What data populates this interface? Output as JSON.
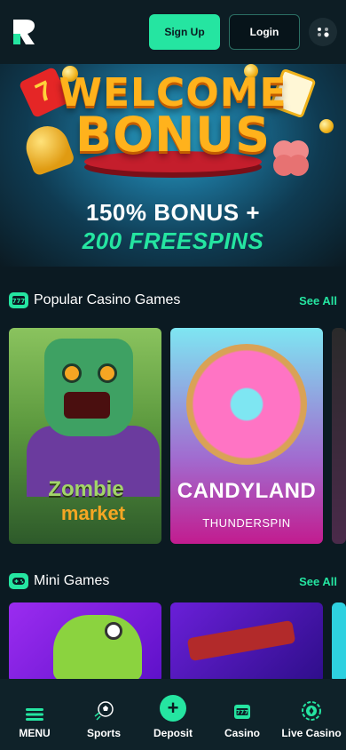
{
  "header": {
    "logo_letter": "R",
    "signup_label": "Sign Up",
    "login_label": "Login"
  },
  "hero": {
    "title_line1": "WELCOME",
    "title_line2": "BONUS",
    "seven": "7",
    "bonus_text": "150% BONUS +",
    "freespins_text": "200 FREESPINS"
  },
  "popular": {
    "title": "Popular Casino Games",
    "see_all": "See All",
    "games": [
      {
        "name": "Zombie",
        "subname": "market"
      },
      {
        "name": "CANDYLAND",
        "provider": "THUNDERSPIN"
      }
    ]
  },
  "mini": {
    "title": "Mini Games",
    "see_all": "See All"
  },
  "nav": {
    "items": [
      {
        "label": "MENU",
        "icon": "menu-icon"
      },
      {
        "label": "Sports",
        "icon": "soccer-ball-icon"
      },
      {
        "label": "Deposit",
        "icon": "plus-icon"
      },
      {
        "label": "Casino",
        "icon": "slot-machine-icon"
      },
      {
        "label": "Live Casino",
        "icon": "poker-chip-icon"
      }
    ],
    "deposit_symbol": "+"
  },
  "colors": {
    "accent": "#25e5a1",
    "background": "#0b1a22",
    "header": "#0d1d24"
  }
}
